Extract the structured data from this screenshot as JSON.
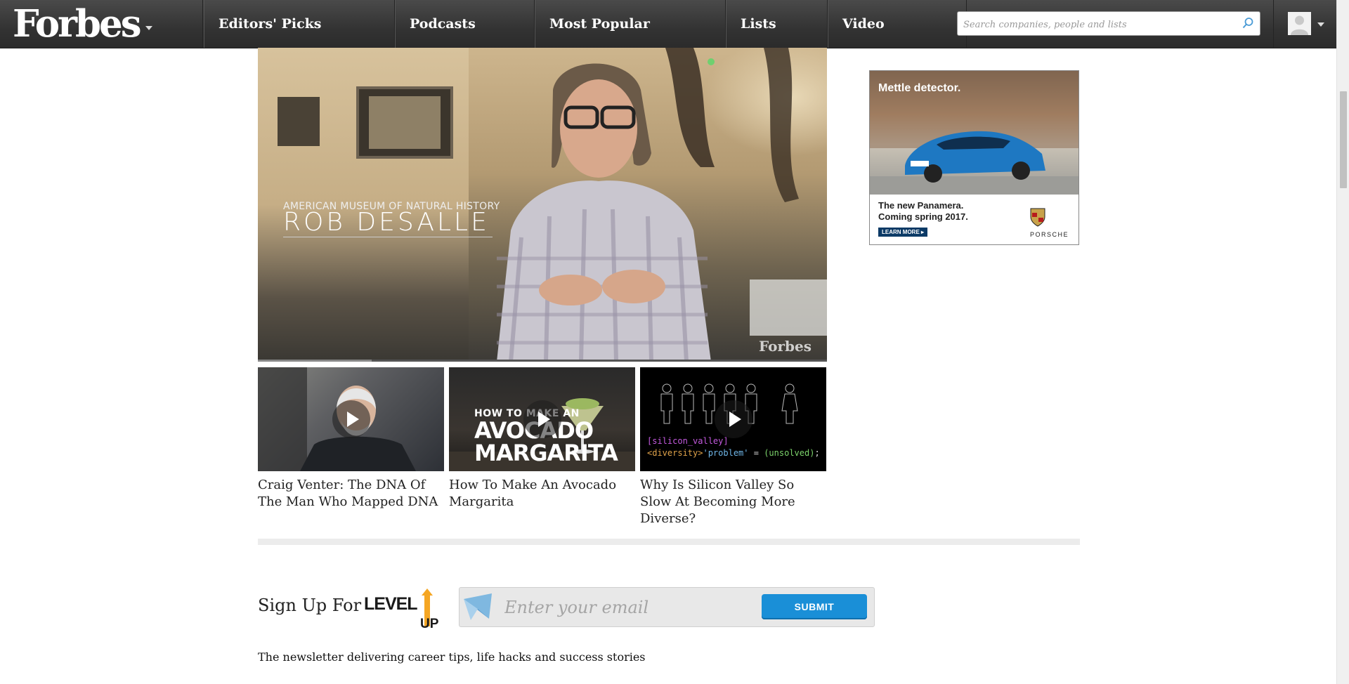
{
  "nav": {
    "logo": "Forbes",
    "items": [
      "Editors' Picks",
      "Podcasts",
      "Most Popular",
      "Lists",
      "Video"
    ],
    "search_placeholder": "Search companies, people and lists"
  },
  "main_video": {
    "caption_small": "AMERICAN MUSEUM OF NATURAL HISTORY",
    "caption_big": "ROB DESALLE",
    "watermark": "Forbes",
    "progress": 0.2
  },
  "thumbnails": [
    {
      "title": "Craig Venter: The DNA Of The Man Who Mapped DNA"
    },
    {
      "title": "How To Make An Avocado Margarita",
      "overlay_line1": "HOW TO MAKE AN",
      "overlay_line2": "AVOCADO",
      "overlay_line3": "MARGARITA"
    },
    {
      "title": "Why Is Silicon Valley So Slow At Becoming More Diverse?",
      "code_line1": "[silicon_valley]",
      "code_line2_a": "<diversity>",
      "code_line2_b": "'problem'",
      "code_line2_c": " = ",
      "code_line2_d": "(unsolved)",
      "code_line2_e": ";"
    }
  ],
  "ad": {
    "headline": "Mettle detector.",
    "sub1": "The new Panamera.",
    "sub2": "Coming spring 2017.",
    "learn_more": "LEARN MORE ▸",
    "brand": "PORSCHE"
  },
  "newsletter": {
    "signup_label": "Sign Up For",
    "logo_text_a": "LEVEL",
    "logo_text_b": "UP",
    "email_placeholder": "Enter your email",
    "submit_label": "SUBMIT",
    "tagline": "The newsletter delivering career tips, life hacks and success stories"
  },
  "colors": {
    "nav_bg": "#333333",
    "submit_blue": "#1a8fd7",
    "levelup_orange": "#f5a623"
  }
}
